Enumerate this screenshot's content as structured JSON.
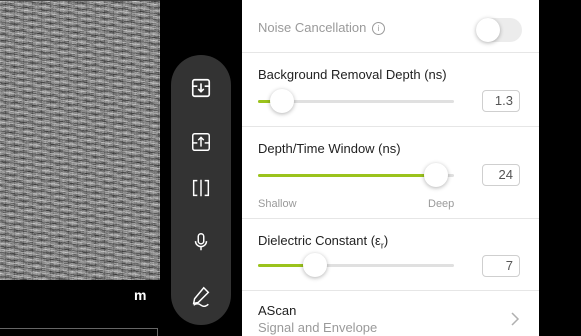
{
  "scan": {
    "unit_label": "m"
  },
  "tools": [
    {
      "icon": "import-tray-icon"
    },
    {
      "icon": "export-tray-icon"
    },
    {
      "icon": "split-view-icon"
    },
    {
      "icon": "microphone-icon"
    },
    {
      "icon": "pen-icon"
    }
  ],
  "settings": {
    "noise": {
      "label": "Noise Cancellation",
      "info_glyph": "i",
      "enabled": false
    },
    "bg_removal": {
      "label": "Background Removal Depth (ns)",
      "value": "1.3",
      "slider_fraction": 0.12
    },
    "depth_window": {
      "label": "Depth/Time Window (ns)",
      "value": "24",
      "slider_fraction": 0.91,
      "min_label": "Shallow",
      "max_label": "Deep"
    },
    "dielectric": {
      "label": "Dielectric Constant (ε",
      "label_sub": "r",
      "label_end": ")",
      "value": "7",
      "slider_fraction": 0.29
    },
    "ascan": {
      "title": "AScan",
      "subtitle": "Signal and Envelope"
    }
  },
  "colors": {
    "accent": "#9bc31c",
    "rail": "#333333",
    "panel": "#ffffff"
  }
}
